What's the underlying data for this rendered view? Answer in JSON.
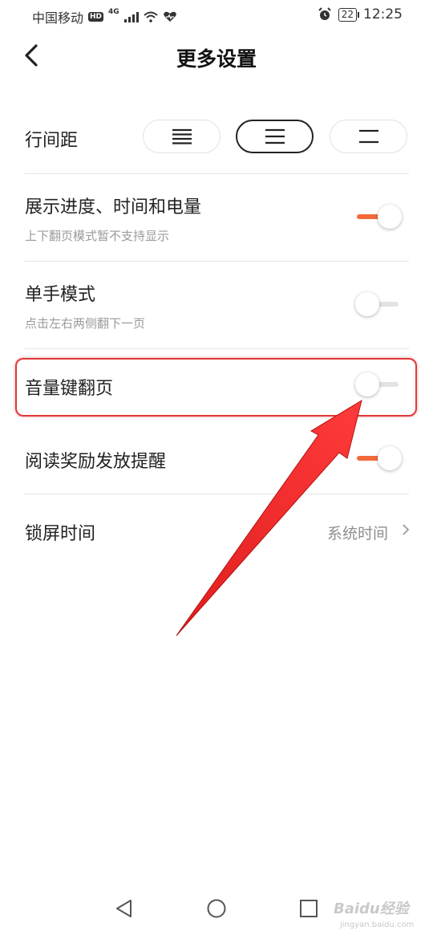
{
  "status_bar": {
    "carrier": "中国移动",
    "hd": "HD",
    "network": "4G",
    "battery": "22",
    "time": "12:25"
  },
  "header": {
    "title": "更多设置",
    "back_icon": "chevron-left-icon"
  },
  "line_spacing": {
    "label": "行间距",
    "options": [
      {
        "icon": "compact-lines-icon",
        "selected": false
      },
      {
        "icon": "medium-lines-icon",
        "selected": true
      },
      {
        "icon": "loose-lines-icon",
        "selected": false
      }
    ]
  },
  "settings": [
    {
      "label": "展示进度、时间和电量",
      "subtitle": "上下翻页模式暂不支持显示",
      "enabled": true
    },
    {
      "label": "单手模式",
      "subtitle": "点击左右两侧翻下一页",
      "enabled": false
    },
    {
      "label": "音量键翻页",
      "subtitle": "",
      "enabled": false,
      "highlighted": true
    },
    {
      "label": "阅读奖励发放提醒",
      "subtitle": "",
      "enabled": true
    }
  ],
  "lock_screen": {
    "label": "锁屏时间",
    "value": "系统时间"
  },
  "colors": {
    "toggle_on": "#f26a3a",
    "toggle_off": "#e3e3e3",
    "annotation_red": "#e03a3a"
  },
  "watermark": {
    "text": "Baidu经验",
    "sub": "jingyan.baidu.com"
  },
  "nav_icons": [
    "back-triangle-icon",
    "home-circle-icon",
    "recents-square-icon"
  ]
}
